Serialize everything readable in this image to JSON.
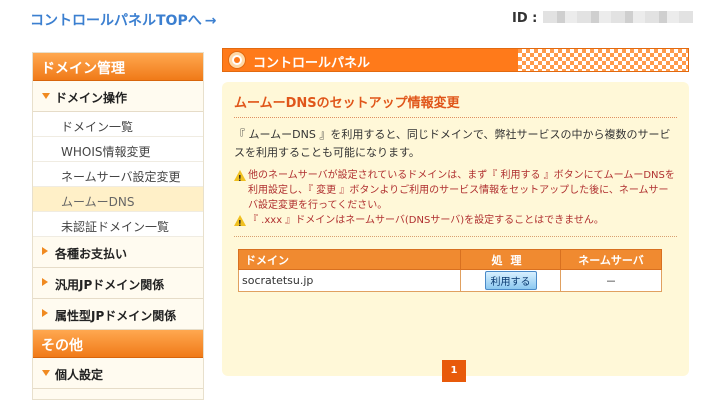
{
  "header": {
    "top_link": "コントロールパネルTOPへ",
    "top_link_arrow": "→",
    "id_label": "ID :"
  },
  "sidebar": {
    "section_domain": "ドメイン管理",
    "group_domain_ops": "ドメイン操作",
    "items": [
      {
        "label": "ドメイン一覧"
      },
      {
        "label": "WHOIS情報変更"
      },
      {
        "label": "ネームサーバ設定変更"
      },
      {
        "label": "ムームーDNS"
      },
      {
        "label": "未認証ドメイン一覧"
      }
    ],
    "group_payment": "各種お支払い",
    "group_jp": "汎用JPドメイン関係",
    "group_attr_jp": "属性型JPドメイン関係",
    "section_other": "その他",
    "group_personal": "個人設定"
  },
  "panel": {
    "title": "コントロールパネル",
    "card_title": "ムームーDNSのセットアップ情報変更",
    "intro": "『 ムームーDNS 』を利用すると、同じドメインで、弊社サービスの中から複数のサービスを利用することも可能になります。",
    "note1": "他のネームサーバが設定されているドメインは、まず『 利用する 』ボタンにてムームーDNSを利用設定し、『 変更 』ボタンよりご利用のサービス情報をセットアップした後に、ネームサーバ設定変更を行ってください。",
    "note2": "『 .xxx 』ドメインはネームサーバ(DNSサーバ)を設定することはできません。"
  },
  "table": {
    "headers": {
      "domain": "ドメイン",
      "action": "処理",
      "nameserver": "ネームサーバ"
    },
    "rows": [
      {
        "domain": "socratetsu.jp",
        "action_label": "利用する",
        "nameserver": "－"
      }
    ]
  },
  "pagination": {
    "current_page": "1"
  },
  "colors": {
    "accent_orange": "#ff7a1a",
    "link_blue": "#3b7fd0",
    "card_bg": "#fff8d8",
    "note_red": "#b03030"
  }
}
